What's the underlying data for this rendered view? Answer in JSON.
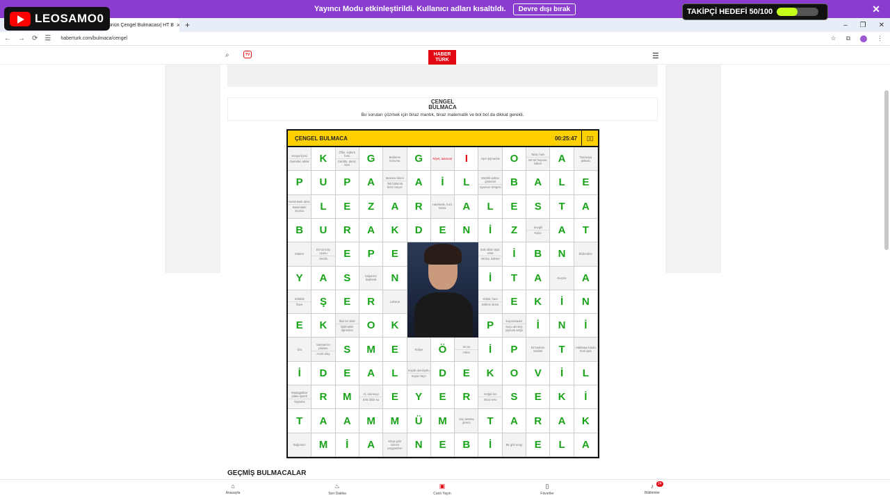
{
  "overlay": {
    "channel_name": "LEOSAMO0",
    "goal_text": "TAKİPÇİ HEDEFİ 50/100",
    "goal_progress": 0.5,
    "close": "✕"
  },
  "streamer_banner": {
    "message": "Yayıncı Modu etkinleştirildi. Kullanıcı adları kısaltıldı.",
    "button": "Devre dışı bırak"
  },
  "browser": {
    "tab_title": "ünün Çengel Bulmacası| HT B",
    "tab_close": "×",
    "new_tab": "+",
    "url": "haberturk.com/bulmaca/cengel",
    "min": "–",
    "restore": "❐",
    "close": "✕"
  },
  "site": {
    "logo_line1": "HABER",
    "logo_line2": "TÜRK",
    "tv": "TV",
    "section_title_1": "ÇENGEL",
    "section_title_2": "BULMACA",
    "section_sub": "Bu soruları çözmek için biraz mantık, biraz matematik ve bol bol da dikkat gerekli."
  },
  "puzzle": {
    "title": "ÇENGEL BULMACA",
    "timer": "00:25:47",
    "rows": [
      [
        "C:Konya ilçesi|Gemiden atlılar",
        "K",
        "C:Öfke, kışkırtı hırsı|Gürültü, deniz, kimi",
        "G",
        "C:Bekleme konumu",
        "G",
        "C:Nİyet, tasavvur",
        "CUR:I",
        "C:Aşırı şişmanlık",
        "O",
        "C:Tatar, hanı|Bir tür hayvan, kılkım",
        "A",
        "C:Tanzanya plakası"
      ],
      [
        "P",
        "U",
        "P",
        "A",
        "C:Meleme biken|Tek bölümlü kürü meyve",
        "A",
        "İ",
        "L",
        "C:Müzikli sahne gösterisi|Uyumun simgesi",
        "B",
        "A",
        "L",
        "E"
      ],
      [
        "C:Kertenkele denir|Basımdaki oyuncu",
        "L",
        "E",
        "Z",
        "A",
        "R",
        "C:Hareketle, hızlı, tekrar",
        "A",
        "L",
        "E",
        "S",
        "T",
        "A"
      ],
      [
        "B",
        "U",
        "R",
        "A",
        "K",
        "D",
        "E",
        "N",
        "İ",
        "Z",
        "C:Sevgili|Kalıcı",
        "A",
        "T"
      ],
      [
        "C:Matem",
        "C:Bir tür kılıç oyunu|Sevda",
        "E",
        "P",
        "E",
        "PH",
        "PH",
        "PH",
        "C:Eski dilde oğul, evlat|Varma, ödeme",
        "İ",
        "B",
        "N",
        "C:Birdenbire"
      ],
      [
        "Y",
        "A",
        "S",
        "C:İtalya'nın başkenti",
        "N",
        "PH",
        "PH",
        "PH",
        "İ",
        "T",
        "A",
        "C:Geçme",
        "A"
      ],
      [
        "C:Kötülük|İlave",
        "Ş",
        "E",
        "R",
        "C:Lahana",
        "PH",
        "PH",
        "PH",
        "C:Kültür, hanı|Dökme demir",
        "E",
        "K",
        "İ",
        "N"
      ],
      [
        "E",
        "K",
        "C:İlkel bir silah|İşitilmekle öğrenilen",
        "O",
        "K",
        "PH",
        "PH",
        "PH",
        "P",
        "C:Kayınbirader|Suçu alınmış yiyecek artığı",
        "İ",
        "N",
        "İ"
      ],
      [
        "C:Ütü",
        "C:Surinam'ın plakası|Acıklı olay",
        "S",
        "M",
        "E",
        "C:Tediye",
        "Ö",
        "C:Sıcım|Asker",
        "İ",
        "P",
        "C:Bir kalenin tesilimi",
        "T",
        "C:Hakkaşa konan hom işek"
      ],
      [
        "İ",
        "D",
        "E",
        "A",
        "L",
        "C:Küçük demiryolu|Koyun tüyü",
        "D",
        "E",
        "K",
        "O",
        "V",
        "İ",
        "L"
      ],
      [
        "C:Madagaskar plaka işareti|Yaylama",
        "R",
        "M",
        "C:Al, oturmayı|Eski dilde su",
        "E",
        "Y",
        "E",
        "R",
        "C:Doğal set|Boru sesi",
        "S",
        "E",
        "K",
        "İ"
      ],
      [
        "T",
        "A",
        "A",
        "M",
        "M",
        "Ü",
        "M",
        "C:Saç tarama gereci",
        "T",
        "A",
        "R",
        "A",
        "K"
      ],
      [
        "C:Bağımsız",
        "M",
        "İ",
        "A",
        "C:Kitap gelir mimeri peygamber",
        "N",
        "E",
        "B",
        "İ",
        "C:Bir göz rengi",
        "E",
        "L",
        "A"
      ]
    ]
  },
  "sections": {
    "past": "GEÇMİŞ BULMACALAR"
  },
  "bottom_nav": {
    "home": "Anasayfa",
    "latest": "Son Dakika",
    "live": "Canlı Yayın",
    "favorites": "Favoriler",
    "notifications": "Bildirimler",
    "notif_count": "24"
  },
  "icons": {
    "search": "search-icon",
    "menu": "hamburger-icon",
    "tv": "tv-icon"
  }
}
